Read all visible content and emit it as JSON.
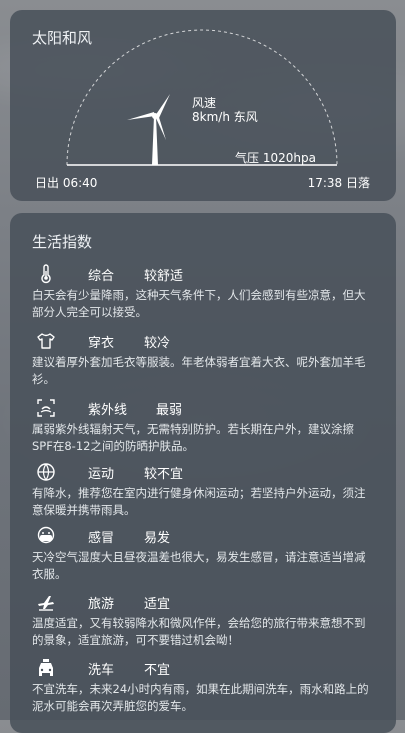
{
  "sun_wind": {
    "title": "太阳和风",
    "wind_title": "风速",
    "wind_value": "8km/h 东风",
    "pressure": "气压 1020hpa",
    "sunrise": "日出 06:40",
    "sunset": "17:38 日落"
  },
  "life_index": {
    "title": "生活指数",
    "items": [
      {
        "icon": "thermometer-icon",
        "name": "综合",
        "level": "较舒适",
        "desc": "白天会有少量降雨，这种天气条件下，人们会感到有些凉意，但大部分人完全可以接受。"
      },
      {
        "icon": "tshirt-icon",
        "name": "穿衣",
        "level": "较冷",
        "desc": "建议着厚外套加毛衣等服装。年老体弱者宜着大衣、呢外套加羊毛衫。"
      },
      {
        "icon": "uv-icon",
        "name": "紫外线",
        "level": "最弱",
        "desc": "属弱紫外线辐射天气，无需特别防护。若长期在户外，建议涂擦SPF在8-12之间的防晒护肤品。"
      },
      {
        "icon": "ball-icon",
        "name": "运动",
        "level": "较不宜",
        "desc": "有降水，推荐您在室内进行健身休闲运动；若坚持户外运动，须注意保暖并携带雨具。"
      },
      {
        "icon": "mask-icon",
        "name": "感冒",
        "level": "易发",
        "desc": "天冷空气湿度大且昼夜温差也很大，易发生感冒，请注意适当增减衣服。"
      },
      {
        "icon": "airplane-icon",
        "name": "旅游",
        "level": "适宜",
        "desc": "温度适宜，又有较弱降水和微风作伴，会给您的旅行带来意想不到的景象，适宜旅游，可不要错过机会呦！"
      },
      {
        "icon": "car-icon",
        "name": "洗车",
        "level": "不宜",
        "desc": "不宜洗车，未来24小时内有雨，如果在此期间洗车，雨水和路上的泥水可能会再次弄脏您的爱车。"
      }
    ]
  }
}
